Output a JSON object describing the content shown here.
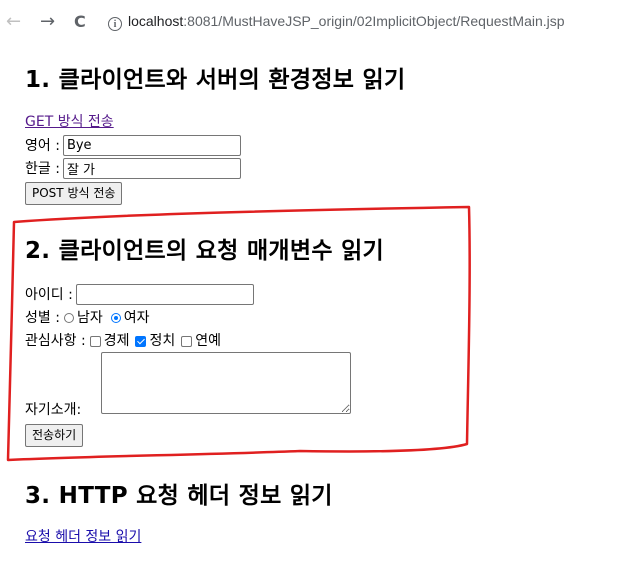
{
  "browser": {
    "back_icon": "←",
    "forward_icon": "→",
    "reload_icon": "C",
    "info_icon": "i",
    "url_host": "localhost",
    "url_rest": ":8081/MustHaveJSP_origin/02ImplicitObject/RequestMain.jsp"
  },
  "section1": {
    "heading": "1. 클라이언트와 서버의 환경정보 읽기",
    "get_link": "GET 방식 전송",
    "eng_label": "영어 :",
    "eng_value": "Bye",
    "kor_label": "한글 :",
    "kor_value": "잘 가",
    "post_button": "POST 방식 전송"
  },
  "section2": {
    "heading": "2. 클라이언트의 요청 매개변수 읽기",
    "id_label": "아이디 :",
    "id_value": "",
    "gender_label": "성별 :",
    "gender_options": [
      "남자",
      "여자"
    ],
    "gender_selected": "여자",
    "interest_label": "관심사항 :",
    "interest_options": [
      "경제",
      "정치",
      "연예"
    ],
    "interest_checked": [
      "정치"
    ],
    "intro_label": "자기소개:",
    "submit_button": "전송하기"
  },
  "section3": {
    "heading": "3. HTTP 요청 헤더 정보 읽기",
    "header_link": "요청 헤더 정보 읽기"
  },
  "colors": {
    "annotation": "#e02020",
    "link": "#1a0dab",
    "visited_link": "#551a8b",
    "accent": "#0075ff"
  }
}
